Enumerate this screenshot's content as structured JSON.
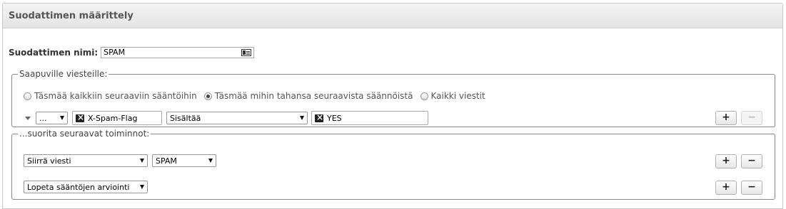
{
  "panel": {
    "title": "Suodattimen määrittely"
  },
  "filter_name": {
    "label": "Suodattimen nimi:",
    "value": "SPAM",
    "icon": "contact-card-icon"
  },
  "incoming": {
    "legend": "Saapuville viesteille:",
    "match_options": [
      {
        "label": "Täsmää kaikkiin seuraaviin sääntöihin",
        "checked": false
      },
      {
        "label": "Täsmää mihin tahansa seuraavista säännöistä",
        "checked": true
      },
      {
        "label": "Kaikki viestit",
        "checked": false
      }
    ],
    "rule": {
      "scope_select": "...",
      "header_field": "X-Spam-Flag",
      "operator_select": "Sisältää",
      "value_field": "YES",
      "add_label": "+",
      "remove_label": "−"
    }
  },
  "actions": {
    "legend": "...suorita seuraavat toiminnot:",
    "rows": [
      {
        "action": "Siirrä viesti",
        "target": "SPAM",
        "add_label": "+",
        "remove_label": "−"
      },
      {
        "action": "Lopeta sääntöjen arviointi",
        "add_label": "+",
        "remove_label": "−"
      }
    ]
  }
}
